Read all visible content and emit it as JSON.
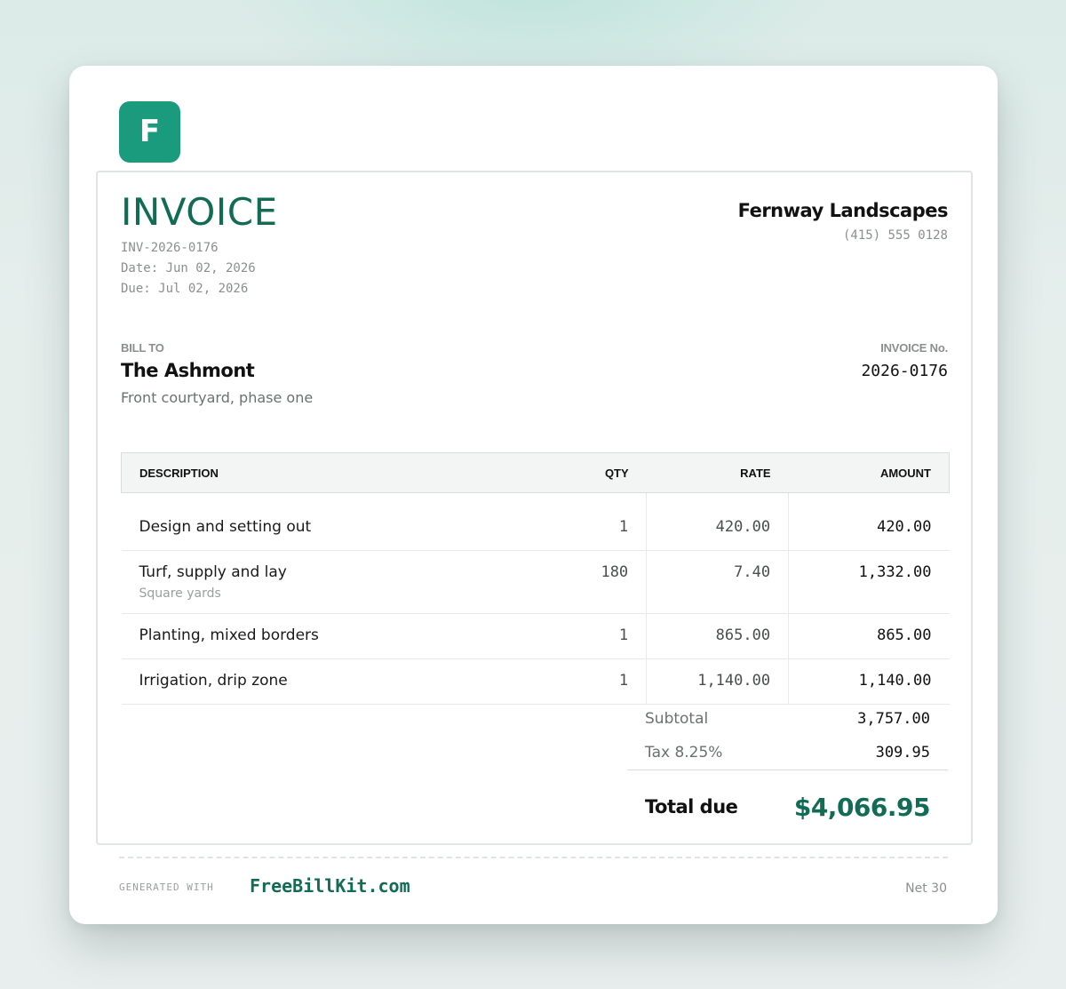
{
  "brand": {
    "logo_letter": "F",
    "accent": "#1a9b7e",
    "primary": "#126b55"
  },
  "invoice": {
    "title": "INVOICE",
    "id": "INV-2026-0176",
    "date_line": "Date: Jun 02, 2026",
    "due_line": "Due: Jul 02, 2026",
    "number_label": "INVOICE No.",
    "number": "2026-0176"
  },
  "company": {
    "name": "Fernway Landscapes",
    "phone": "(415) 555 0128"
  },
  "bill_to": {
    "label": "BILL TO",
    "name": "The Ashmont",
    "note": "Front courtyard, phase one"
  },
  "table": {
    "headers": {
      "description": "DESCRIPTION",
      "qty": "QTY",
      "rate": "RATE",
      "amount": "AMOUNT"
    },
    "rows": [
      {
        "description": "Design and setting out",
        "sub": "",
        "qty": "1",
        "rate": "420.00",
        "amount": "420.00"
      },
      {
        "description": "Turf, supply and lay",
        "sub": "Square yards",
        "qty": "180",
        "rate": "7.40",
        "amount": "1,332.00"
      },
      {
        "description": "Planting, mixed borders",
        "sub": "",
        "qty": "1",
        "rate": "865.00",
        "amount": "865.00"
      },
      {
        "description": "Irrigation, drip zone",
        "sub": "",
        "qty": "1",
        "rate": "1,140.00",
        "amount": "1,140.00"
      }
    ]
  },
  "totals": {
    "subtotal_label": "Subtotal",
    "subtotal": "3,757.00",
    "tax_label": "Tax 8.25%",
    "tax": "309.95",
    "total_label": "Total due",
    "total": "$4,066.95"
  },
  "footer": {
    "generated_label": "GENERATED WITH",
    "brand": "FreeBillKit.com",
    "terms": "Net 30"
  }
}
